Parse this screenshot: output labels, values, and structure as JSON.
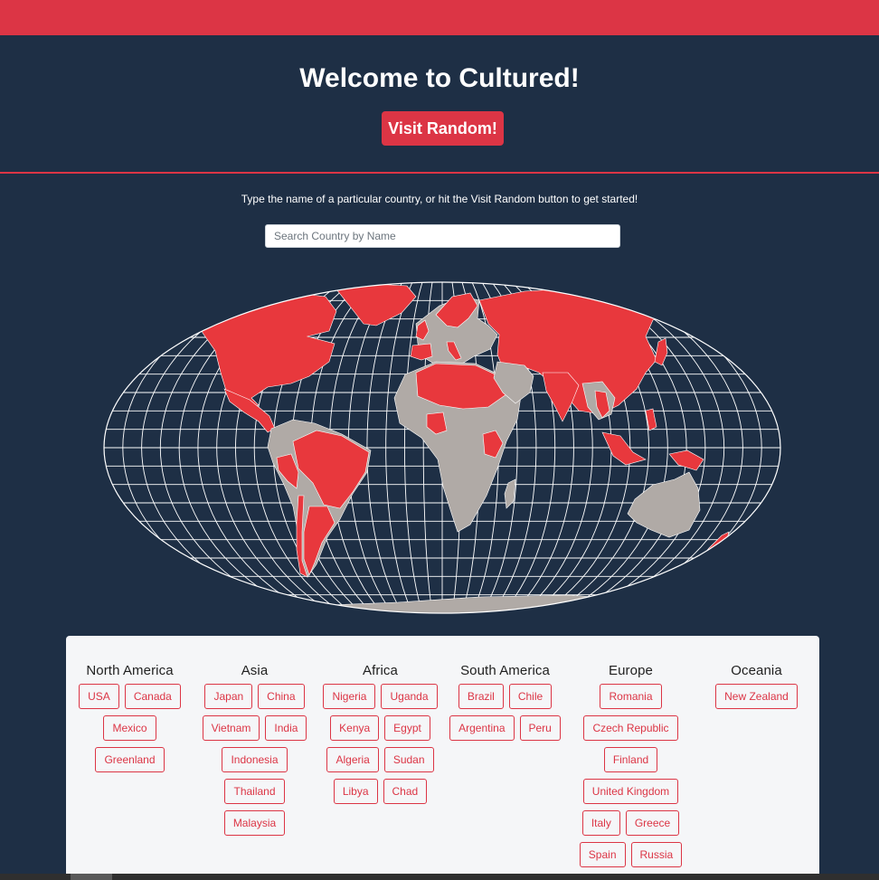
{
  "header": {
    "title": "Welcome to Cultured!",
    "random_button": "Visit Random!"
  },
  "intro": {
    "instructions": "Type the name of a particular country, or hit the Visit Random button to get started!"
  },
  "search": {
    "placeholder": "Search Country by Name",
    "value": ""
  },
  "map": {
    "highlight_color": "#e8383d",
    "unvisited_color": "#b0aaa6",
    "grid_color": "#ffffff"
  },
  "regions": [
    {
      "name": "North America",
      "countries": [
        "USA",
        "Canada",
        "Mexico",
        "Greenland"
      ]
    },
    {
      "name": "Asia",
      "countries": [
        "Japan",
        "China",
        "Vietnam",
        "India",
        "Indonesia",
        "Thailand",
        "Malaysia"
      ]
    },
    {
      "name": "Africa",
      "countries": [
        "Nigeria",
        "Uganda",
        "Kenya",
        "Egypt",
        "Algeria",
        "Sudan",
        "Libya",
        "Chad"
      ]
    },
    {
      "name": "South America",
      "countries": [
        "Brazil",
        "Chile",
        "Argentina",
        "Peru"
      ]
    },
    {
      "name": "Europe",
      "countries": [
        "Romania",
        "Czech Republic",
        "Finland",
        "United Kingdom",
        "Italy",
        "Greece",
        "Spain",
        "Russia"
      ]
    },
    {
      "name": "Oceania",
      "countries": [
        "New Zealand"
      ]
    }
  ],
  "colors": {
    "accent": "#dc3545",
    "background": "#1e2f45",
    "panel": "#f5f6f8"
  }
}
